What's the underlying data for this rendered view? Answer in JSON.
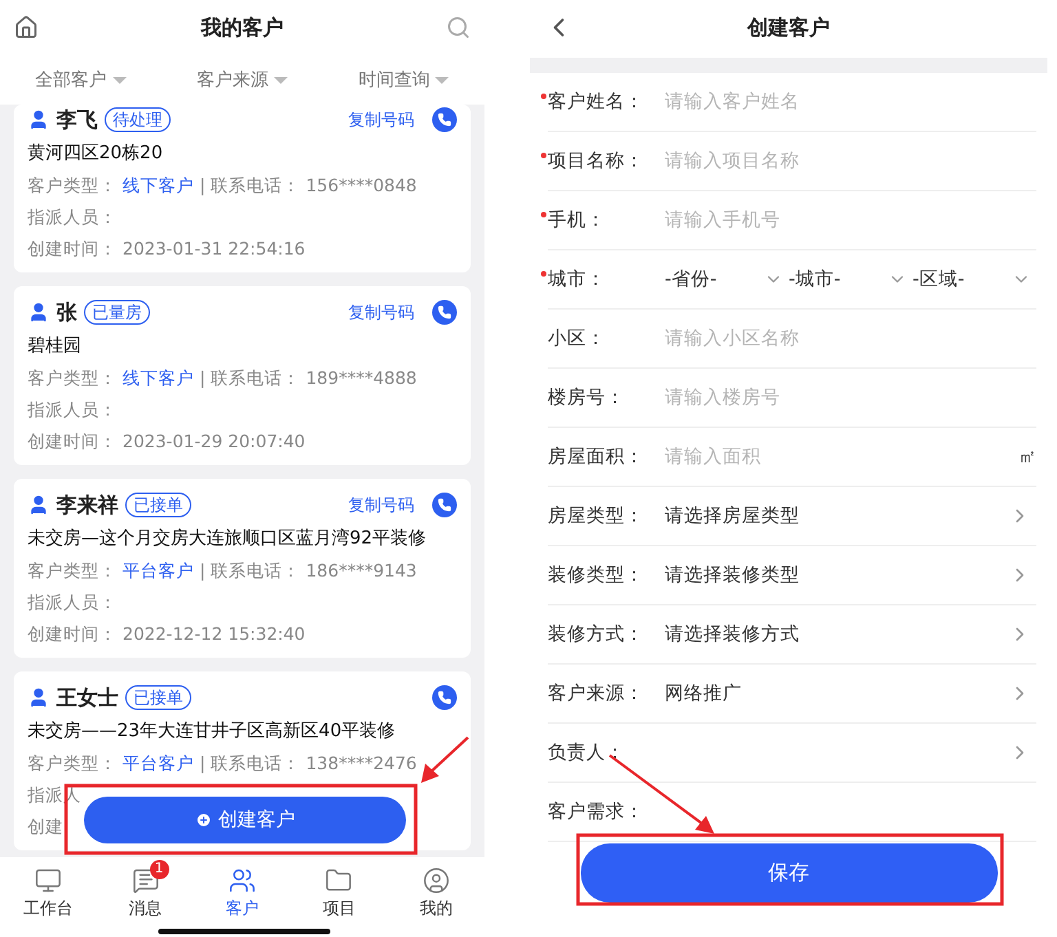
{
  "customer_list": {
    "title": "我的客户",
    "filters": [
      "全部客户",
      "客户来源",
      "时间查询"
    ],
    "customers": [
      {
        "name": "李飞",
        "status": "待处理",
        "copy": "复制号码",
        "address": "黄河四区20栋20",
        "type_label": "客户类型：",
        "type": "线下客户",
        "separator": "|",
        "phone_label": "联系电话：",
        "phone": "156****0848",
        "assignee_label": "指派人员：",
        "created_label": "创建时间：",
        "created": "2023-01-31 22:54:16"
      },
      {
        "name": "张",
        "status": "已量房",
        "copy": "复制号码",
        "address": "碧桂园",
        "type_label": "客户类型：",
        "type": "线下客户",
        "separator": "|",
        "phone_label": "联系电话：",
        "phone": "189****4888",
        "assignee_label": "指派人员：",
        "created_label": "创建时间：",
        "created": "2023-01-29 20:07:40"
      },
      {
        "name": "李来祥",
        "status": "已接单",
        "copy": "复制号码",
        "address": "未交房—这个月交房大连旅顺口区蓝月湾92平装修",
        "type_label": "客户类型：",
        "type": "平台客户",
        "separator": "|",
        "phone_label": "联系电话：",
        "phone": "186****9143",
        "assignee_label": "指派人员：",
        "created_label": "创建时间：",
        "created": "2022-12-12 15:32:40"
      },
      {
        "name": "王女士",
        "status": "已接单",
        "address": "未交房——23年大连甘井子区高新区40平装修",
        "type_label": "客户类型：",
        "type": "平台客户",
        "separator": "|",
        "phone_label": "联系电话：",
        "phone": "138****2476",
        "assignee_label": "指派人",
        "created_label": "创建"
      }
    ],
    "create_button": "创建客户",
    "tabbar": [
      {
        "label": "工作台",
        "selected": false
      },
      {
        "label": "消息",
        "selected": false,
        "badge": "1"
      },
      {
        "label": "客户",
        "selected": true
      },
      {
        "label": "项目",
        "selected": false
      },
      {
        "label": "我的",
        "selected": false
      }
    ]
  },
  "create_form": {
    "title": "创建客户",
    "save_button": "保存",
    "rows": [
      {
        "kind": "input",
        "required": true,
        "label": "客户姓名：",
        "placeholder": "请输入客户姓名"
      },
      {
        "kind": "input",
        "required": true,
        "label": "项目名称：",
        "placeholder": "请输入项目名称"
      },
      {
        "kind": "input",
        "required": true,
        "label": "手机：",
        "placeholder": "请输入手机号"
      },
      {
        "kind": "city",
        "required": true,
        "label": "城市：",
        "selects": [
          "-省份-",
          "-城市-",
          "-区域-"
        ]
      },
      {
        "kind": "input",
        "required": false,
        "label": "小区：",
        "placeholder": "请输入小区名称"
      },
      {
        "kind": "input",
        "required": false,
        "label": "楼房号：",
        "placeholder": "请输入楼房号"
      },
      {
        "kind": "input",
        "required": false,
        "label": "房屋面积：",
        "placeholder": "请输入面积",
        "unit": "㎡"
      },
      {
        "kind": "select",
        "required": false,
        "label": "房屋类型：",
        "value": "请选择房屋类型"
      },
      {
        "kind": "select",
        "required": false,
        "label": "装修类型：",
        "value": "请选择装修类型"
      },
      {
        "kind": "select",
        "required": false,
        "label": "装修方式：",
        "value": "请选择装修方式"
      },
      {
        "kind": "select",
        "required": false,
        "label": "客户来源：",
        "value": "网络推广"
      },
      {
        "kind": "select",
        "required": false,
        "label": "负责人："
      },
      {
        "kind": "text",
        "required": false,
        "label": "客户需求："
      }
    ]
  }
}
